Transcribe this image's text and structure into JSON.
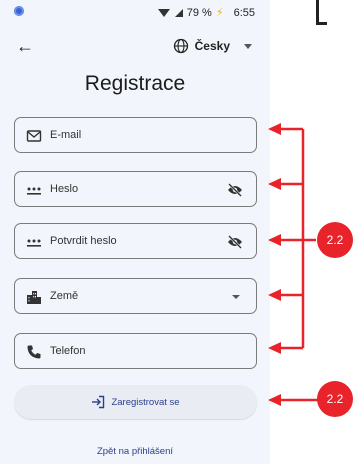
{
  "status": {
    "battery": "79 %",
    "time": "6:55"
  },
  "appbar": {
    "language": "Česky"
  },
  "title": "Registrace",
  "fields": {
    "email": "E-mail",
    "password": "Heslo",
    "confirm": "Potvrdit heslo",
    "country": "Země",
    "phone": "Telefon"
  },
  "register_button": "Zaregistrovat se",
  "login_link": "Zpět na přihlášení",
  "annotations": {
    "badge_1": "2.2",
    "badge_2": "2.2"
  },
  "colors": {
    "accent": "#2a3f8c",
    "annotation": "#e8232a",
    "background": "#f2f5fb"
  }
}
